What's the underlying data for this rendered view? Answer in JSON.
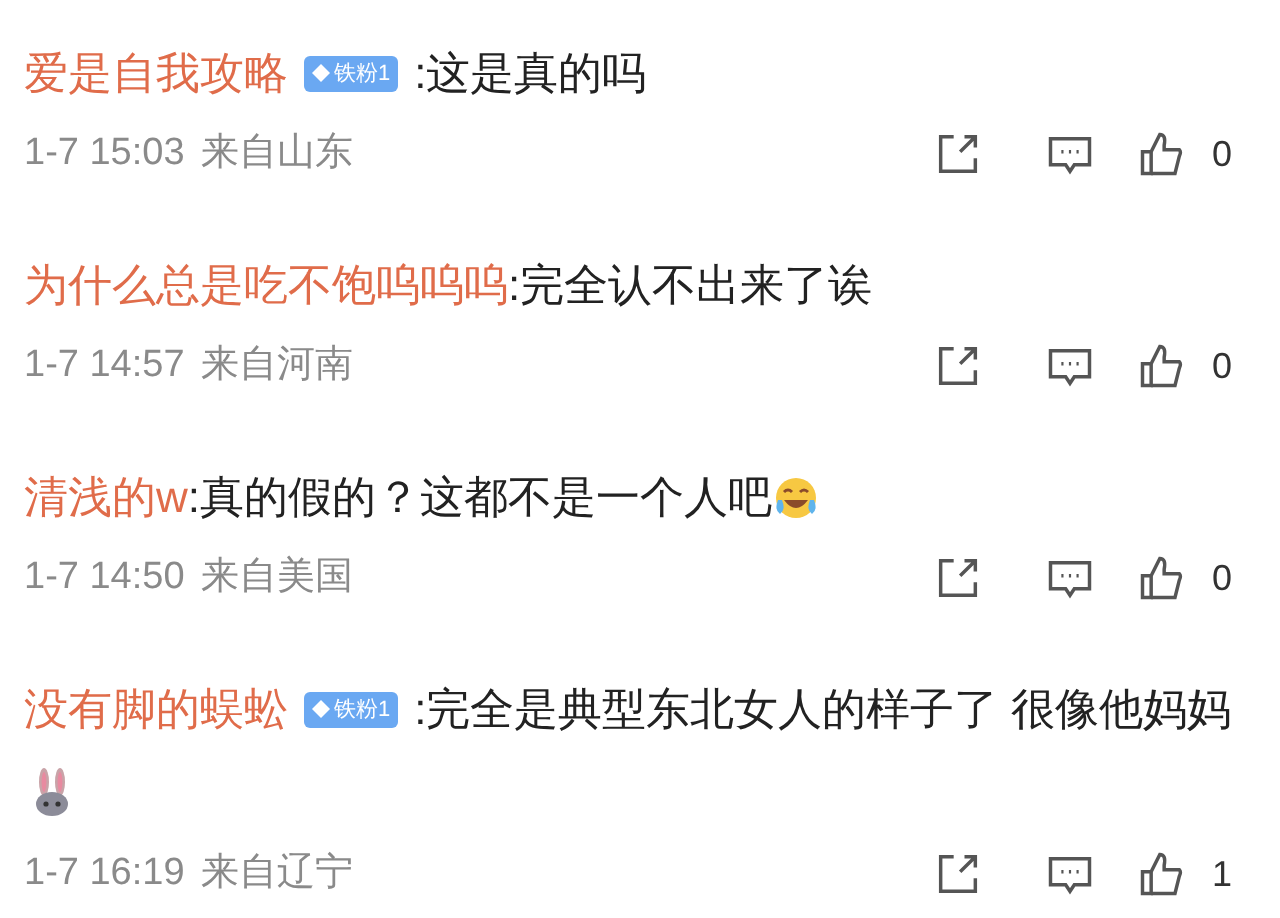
{
  "comments": [
    {
      "user": "爱是自我攻略",
      "badge": "铁粉1",
      "text": ":这是真的吗",
      "time": "1-7 15:03",
      "location": "来自山东",
      "likes": "0"
    },
    {
      "user": "为什么总是吃不饱呜呜呜",
      "text": ":完全认不出来了诶",
      "time": "1-7 14:57",
      "location": "来自河南",
      "likes": "0"
    },
    {
      "user": "清浅的w",
      "text": ":真的假的？这都不是一个人吧",
      "emoji": {
        "kind": "laughing"
      },
      "time": "1-7 14:50",
      "location": "来自美国",
      "likes": "0"
    },
    {
      "user": "没有脚的蜈蚣",
      "badge": "铁粉1",
      "text": ":完全是典型东北女人的样子了 很像他妈妈",
      "emoji": {
        "kind": "rabbit"
      },
      "time": "1-7 16:19",
      "location": "来自辽宁",
      "likes": "1"
    }
  ]
}
